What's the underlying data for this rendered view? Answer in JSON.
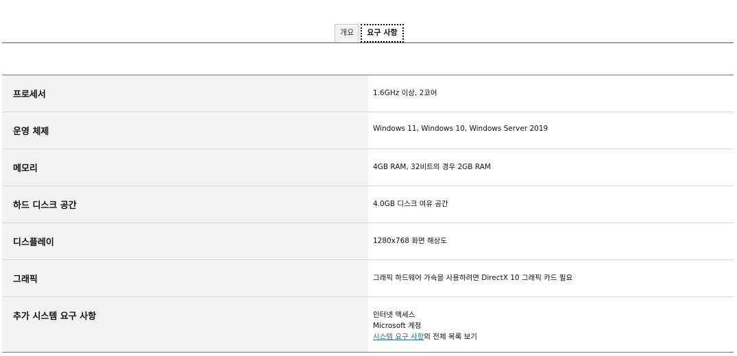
{
  "tabs": [
    {
      "label": "개요"
    },
    {
      "label": "요구 사항"
    }
  ],
  "requirements": [
    {
      "label": "프로세서",
      "value": "1.6GHz 이상, 2코어"
    },
    {
      "label": "운영 체제",
      "value": "Windows 11, Windows 10, Windows Server 2019"
    },
    {
      "label": "메모리",
      "value": "4GB RAM, 32비트의 경우 2GB RAM"
    },
    {
      "label": "하드 디스크 공간",
      "value": "4.0GB 디스크 여유 공간"
    },
    {
      "label": "디스플레이",
      "value": "1280x768 화면 해상도"
    },
    {
      "label": "그래픽",
      "value": "그래픽 하드웨어 가속을 사용하려면 DirectX 10 그래픽 카드 필요"
    },
    {
      "label": "추가 시스템 요구 사항",
      "lines": [
        "인터넷 액세스",
        "Microsoft 계정"
      ],
      "link_text": "시스템 요구 사항",
      "link_suffix": "의 전체 목록 보기"
    }
  ],
  "colors": {
    "label_bg": "#f2f2f2",
    "link": "#1a6fb0"
  }
}
